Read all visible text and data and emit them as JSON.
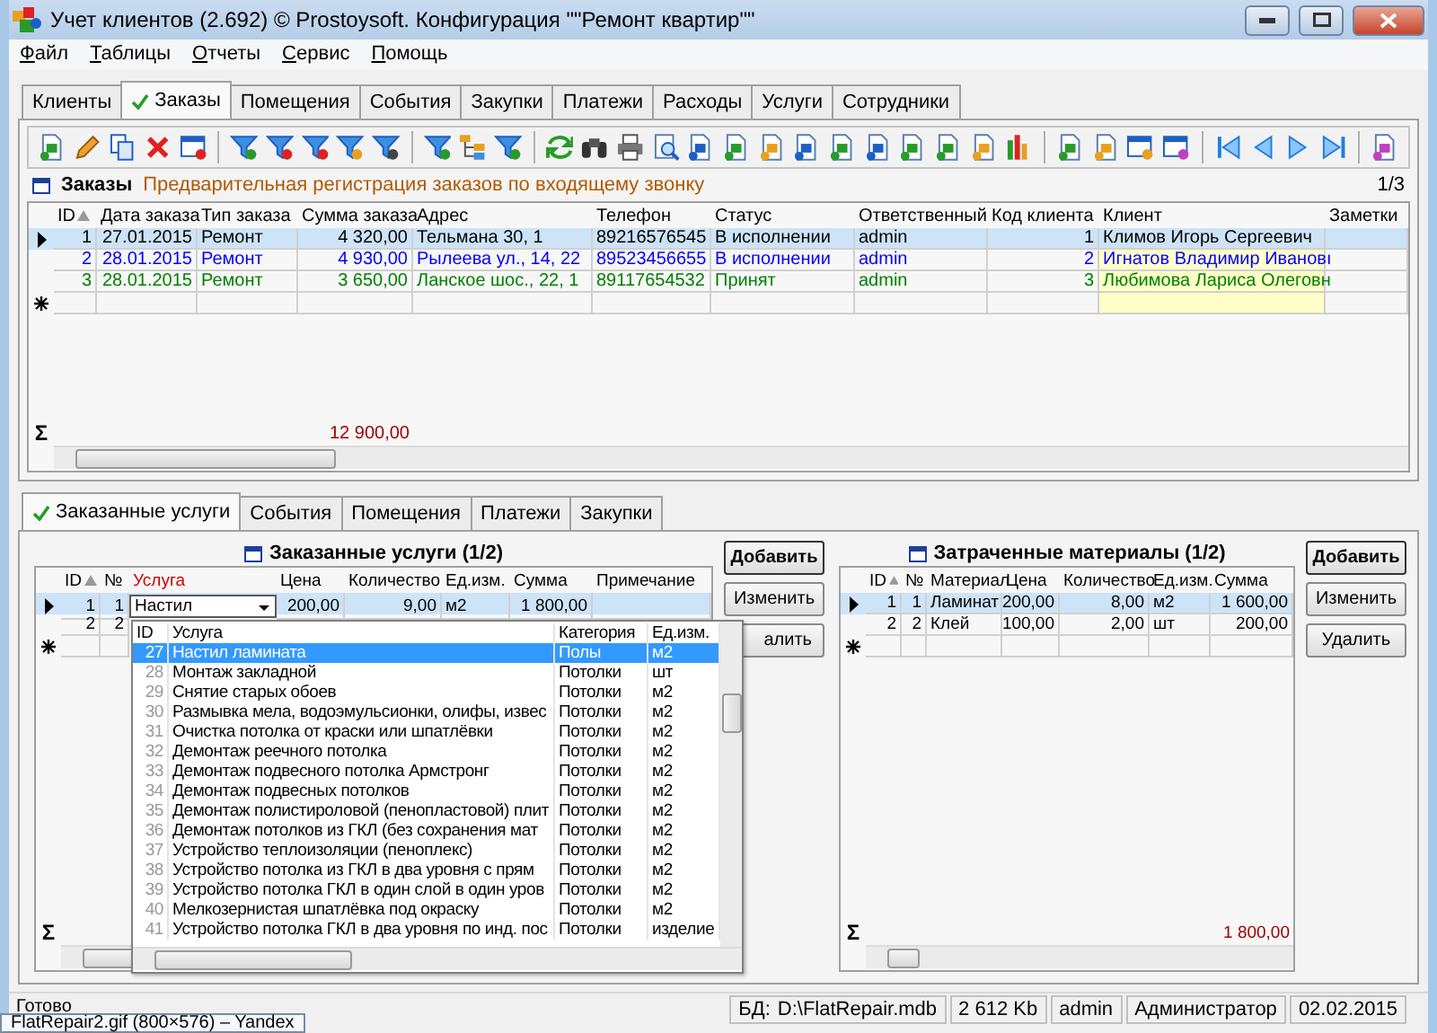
{
  "window": {
    "title": "Учет клиентов (2.692) © Prostoysoft. Конфигурация \"\"Ремонт квартир\"\""
  },
  "menu": [
    "Файл",
    "Таблицы",
    "Отчеты",
    "Сервис",
    "Помощь"
  ],
  "tabs": [
    {
      "label": "Клиенты",
      "selected": false
    },
    {
      "label": "Заказы",
      "selected": true
    },
    {
      "label": "Помещения",
      "selected": false
    },
    {
      "label": "События",
      "selected": false
    },
    {
      "label": "Закупки",
      "selected": false
    },
    {
      "label": "Платежи",
      "selected": false
    },
    {
      "label": "Расходы",
      "selected": false
    },
    {
      "label": "Услуги",
      "selected": false
    },
    {
      "label": "Сотрудники",
      "selected": false
    }
  ],
  "orders": {
    "caption": "Заказы",
    "note": "Предварительная регистрация заказов по входящему звонку",
    "pager": "1/3",
    "total_sign": "Σ",
    "columns": [
      {
        "label": "ID",
        "sorted": true
      },
      {
        "label": "Дата заказа"
      },
      {
        "label": "Тип заказа"
      },
      {
        "label": "Сумма заказа",
        "total": "12 900,00"
      },
      {
        "label": "Адрес"
      },
      {
        "label": "Телефон"
      },
      {
        "label": "Статус"
      },
      {
        "label": "Ответственный"
      },
      {
        "label": "Код клиента"
      },
      {
        "label": "Клиент",
        "highlighted": true
      },
      {
        "label": "Заметки"
      }
    ],
    "rows": [
      {
        "selected": true,
        "color": "#000000",
        "cells": [
          "1",
          "27.01.2015",
          "Ремонт",
          "4 320,00",
          "Тельмана 30, 1",
          "89216576545",
          "В исполнении",
          "admin",
          "1",
          "Климов Игорь Сергеевич",
          ""
        ]
      },
      {
        "selected": false,
        "color": "#0000ff",
        "cells": [
          "2",
          "28.01.2015",
          "Ремонт",
          "4 930,00",
          "Рылеева ул., 14, 22",
          "89523456655",
          "В исполнении",
          "admin",
          "2",
          "Игнатов Владимир Ивановı",
          ""
        ]
      },
      {
        "selected": false,
        "color": "#008000",
        "cells": [
          "3",
          "28.01.2015",
          "Ремонт",
          "3 650,00",
          "Ланское шос., 22, 1",
          "89117654532",
          "Принят",
          "admin",
          "3",
          "Любимова Лариса Олеговн",
          ""
        ]
      }
    ]
  },
  "lower_tabs": [
    {
      "label": "Заказанные услуги",
      "selected": true
    },
    {
      "label": "События",
      "selected": false
    },
    {
      "label": "Помещения",
      "selected": false
    },
    {
      "label": "Платежи",
      "selected": false
    },
    {
      "label": "Закупки",
      "selected": false
    }
  ],
  "services": {
    "caption": "Заказанные услуги (1/2)",
    "total_sign": "Σ",
    "columns": [
      {
        "label": "ID",
        "sorted": true
      },
      {
        "label": "№"
      },
      {
        "label": "Услуга",
        "required": true,
        "kind": "lookup"
      },
      {
        "label": "Цена"
      },
      {
        "label": "Количество"
      },
      {
        "label": "Ед.изм."
      },
      {
        "label": "Сумма"
      },
      {
        "label": "Примечание"
      }
    ],
    "rows": [
      {
        "selected": true,
        "edit": true,
        "cells": [
          "1",
          "1",
          "Настил",
          "200,00",
          "9,00",
          "м2",
          "1 800,00",
          ""
        ]
      },
      {
        "selected": false,
        "cells": [
          "2",
          "2"
        ]
      }
    ],
    "buttons": [
      {
        "label": "Добавить",
        "default": true
      },
      {
        "label": "Изменить",
        "default": false
      },
      {
        "label": "алить"
      }
    ],
    "dropdown": {
      "columns": [
        "ID",
        "Услуга",
        "Категория",
        "Ед.изм."
      ],
      "rows": [
        {
          "selected": true,
          "cells": [
            "27",
            "Настил ламината",
            "Полы",
            "м2"
          ]
        },
        {
          "selected": false,
          "cells": [
            "28",
            "Монтаж закладной",
            "Потолки",
            "шт"
          ]
        },
        {
          "selected": false,
          "cells": [
            "29",
            "Снятие старых обоев",
            "Потолки",
            "м2"
          ]
        },
        {
          "selected": false,
          "cells": [
            "30",
            "Размывка мела, водоэмульсионки, олифы, извес",
            "Потолки",
            "м2"
          ]
        },
        {
          "selected": false,
          "cells": [
            "31",
            "Очистка потолка от краски или шпатлёвки",
            "Потолки",
            "м2"
          ]
        },
        {
          "selected": false,
          "cells": [
            "32",
            "Демонтаж реечного потолка",
            "Потолки",
            "м2"
          ]
        },
        {
          "selected": false,
          "cells": [
            "33",
            "Демонтаж подвесного потолка Армстронг",
            "Потолки",
            "м2"
          ]
        },
        {
          "selected": false,
          "cells": [
            "34",
            "Демонтаж подвесных потолков",
            "Потолки",
            "м2"
          ]
        },
        {
          "selected": false,
          "cells": [
            "35",
            "Демонтаж полистироловой (пенопластовой) плит",
            "Потолки",
            "м2"
          ]
        },
        {
          "selected": false,
          "cells": [
            "36",
            "Демонтаж потолков из ГКЛ (без сохранения мат",
            "Потолки",
            "м2"
          ]
        },
        {
          "selected": false,
          "cells": [
            "37",
            "Устройство теплоизоляции (пеноплекс)",
            "Потолки",
            "м2"
          ]
        },
        {
          "selected": false,
          "cells": [
            "38",
            "Устройство потолка из ГКЛ в два уровня с прям",
            "Потолки",
            "м2"
          ]
        },
        {
          "selected": false,
          "cells": [
            "39",
            "Устройство потолка ГКЛ в один слой в один уров",
            "Потолки",
            "м2"
          ]
        },
        {
          "selected": false,
          "cells": [
            "40",
            "Мелкозернистая шпатлёвка под окраску",
            "Потолки",
            "м2"
          ]
        },
        {
          "selected": false,
          "cells": [
            "41",
            "Устройство потолка ГКЛ в два уровня по инд. пос",
            "Потолки",
            "изделие"
          ]
        }
      ]
    }
  },
  "materials": {
    "caption": "Затраченные материалы (1/2)",
    "total_sign": "Σ",
    "columns": [
      {
        "label": "ID",
        "sorted": true
      },
      {
        "label": "№"
      },
      {
        "label": "Материал"
      },
      {
        "label": "Цена"
      },
      {
        "label": "Количество"
      },
      {
        "label": "Ед.изм."
      },
      {
        "label": "Сумма",
        "total": "1 800,00"
      }
    ],
    "rows": [
      {
        "selected": true,
        "cells": [
          "1",
          "1",
          "Ламинат",
          "200,00",
          "8,00",
          "м2",
          "1 600,00"
        ]
      },
      {
        "selected": false,
        "cells": [
          "2",
          "2",
          "Клей",
          "100,00",
          "2,00",
          "шт",
          "200,00"
        ]
      }
    ],
    "buttons": [
      {
        "label": "Добавить",
        "default": true
      },
      {
        "label": "Изменить",
        "default": false
      },
      {
        "label": "Удалить",
        "default": false
      }
    ]
  },
  "status_bar": {
    "message": "Готово",
    "db_label": "БД:",
    "db_path": "D:\\FlatRepair.mdb",
    "size": "2 612 Kb",
    "user": "admin",
    "role": "Администратор",
    "date": "02.02.2015"
  },
  "tooltip": "FlatRepair2.gif (800×576) – Yandex"
}
